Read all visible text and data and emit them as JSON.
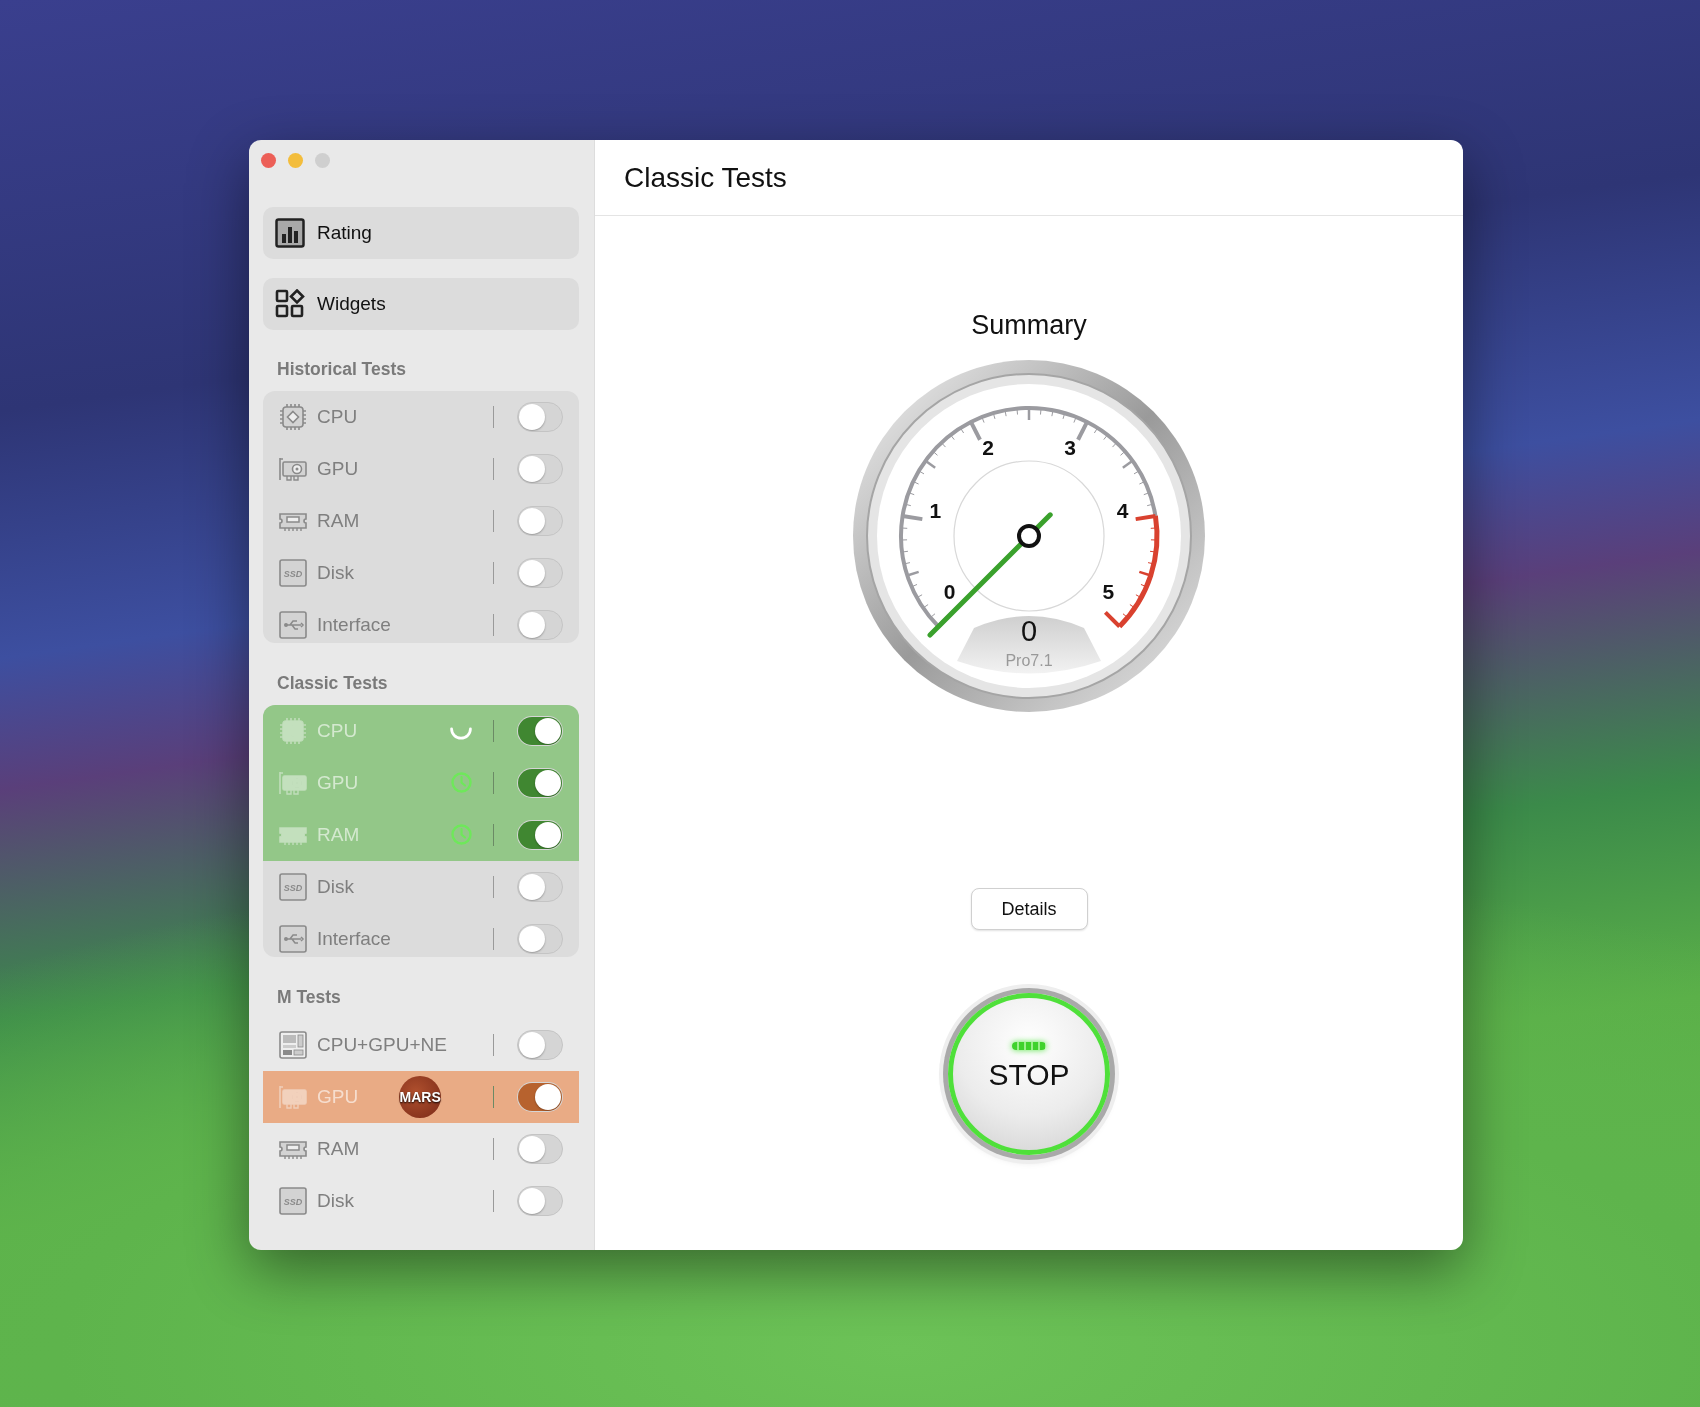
{
  "sidebar": {
    "nav": [
      {
        "label": "Rating",
        "kind": "rating"
      },
      {
        "label": "Widgets",
        "kind": "widgets"
      }
    ],
    "sections": [
      {
        "title": "Historical Tests",
        "boxed": true,
        "items": [
          {
            "label": "CPU",
            "kind": "cpu",
            "on": false,
            "running": false,
            "queued": false
          },
          {
            "label": "GPU",
            "kind": "gpu",
            "on": false,
            "running": false,
            "queued": false
          },
          {
            "label": "RAM",
            "kind": "ram",
            "on": false,
            "running": false,
            "queued": false
          },
          {
            "label": "Disk",
            "kind": "ssd",
            "icon_text": "SSD",
            "on": false,
            "running": false,
            "queued": false
          },
          {
            "label": "Interface",
            "kind": "usb",
            "on": false,
            "running": false,
            "queued": false
          }
        ]
      },
      {
        "title": "Classic Tests",
        "boxed": true,
        "items": [
          {
            "label": "CPU",
            "kind": "cpu",
            "on": true,
            "running": true,
            "queued": false,
            "color": "#93c788"
          },
          {
            "label": "GPU",
            "kind": "gpu",
            "on": true,
            "running": false,
            "queued": true,
            "color": "#93c788"
          },
          {
            "label": "RAM",
            "kind": "ram",
            "on": true,
            "running": false,
            "queued": true,
            "color": "#93c788"
          },
          {
            "label": "Disk",
            "kind": "ssd",
            "icon_text": "SSD",
            "on": false,
            "running": false,
            "queued": false
          },
          {
            "label": "Interface",
            "kind": "usb",
            "on": false,
            "running": false,
            "queued": false
          }
        ]
      },
      {
        "title": "M Tests",
        "boxed": false,
        "items": [
          {
            "label": "CPU+GPU+NE",
            "kind": "soc",
            "on": false,
            "running": false,
            "queued": false
          },
          {
            "label": "GPU",
            "kind": "gpu",
            "on": true,
            "running": false,
            "queued": false,
            "badge": "MARS",
            "color": "#e9ab85"
          },
          {
            "label": "RAM",
            "kind": "ram",
            "on": false,
            "running": false,
            "queued": false
          },
          {
            "label": "Disk",
            "kind": "ssd",
            "icon_text": "SSD",
            "on": false,
            "running": false,
            "queued": false
          }
        ]
      }
    ]
  },
  "main": {
    "title": "Classic Tests",
    "summary": {
      "title": "Summary",
      "gauge": {
        "scale": [
          "0",
          "1",
          "2",
          "3",
          "4",
          "5"
        ],
        "value": "0",
        "caption": "Pro7.1"
      }
    },
    "details_button": "Details",
    "stop_button": "STOP"
  }
}
